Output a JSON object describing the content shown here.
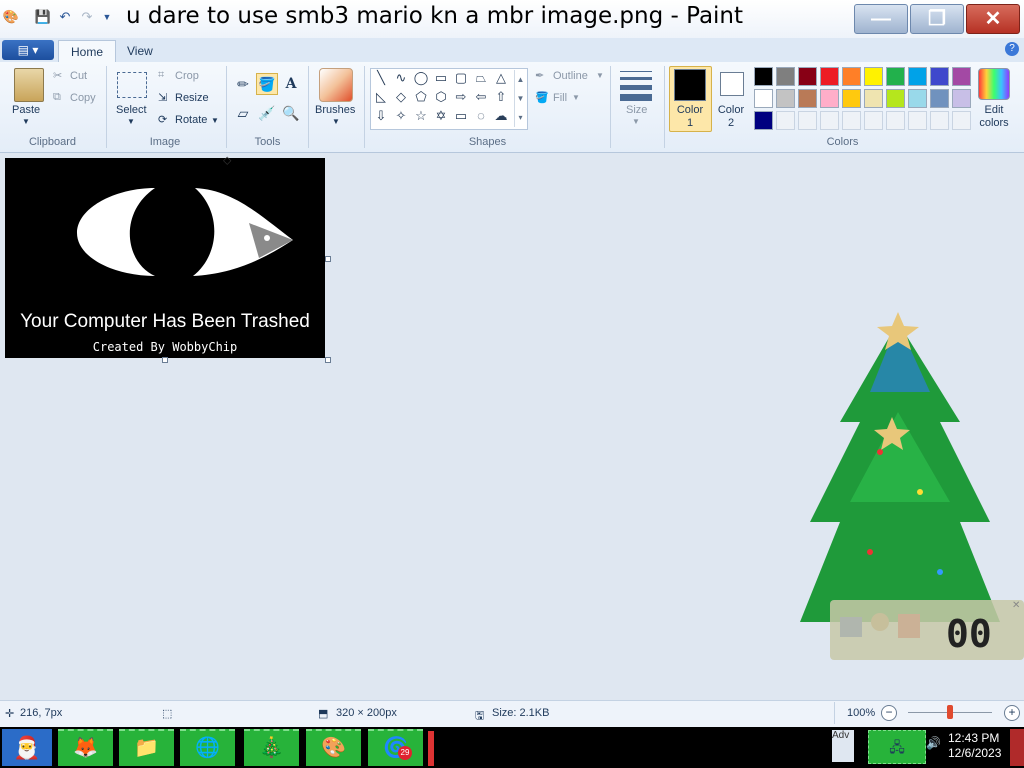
{
  "window": {
    "title": "u dare to use smb3 mario kn a mbr image.png - Paint"
  },
  "ribbon": {
    "tabs": [
      "Home",
      "View"
    ],
    "clipboard": {
      "group": "Clipboard",
      "paste": "Paste",
      "cut": "Cut",
      "copy": "Copy"
    },
    "image": {
      "group": "Image",
      "select": "Select",
      "crop": "Crop",
      "resize": "Resize",
      "rotate": "Rotate"
    },
    "tools": {
      "group": "Tools"
    },
    "brushes": {
      "label": "Brushes"
    },
    "shapes": {
      "group": "Shapes",
      "outline": "Outline",
      "fill": "Fill"
    },
    "size": {
      "label": "Size"
    },
    "colors": {
      "group": "Colors",
      "color1": "Color 1",
      "color2": "Color 2",
      "edit": "Edit colors",
      "color1_value": "#000000",
      "color2_value": "#ffffff",
      "palette": [
        "#000000",
        "#7f7f7f",
        "#880015",
        "#ed1c24",
        "#ff7f27",
        "#fff200",
        "#22b14c",
        "#00a2e8",
        "#3f48cc",
        "#a349a4",
        "#ffffff",
        "#c3c3c3",
        "#b97a57",
        "#ffaec9",
        "#ffc90e",
        "#efe4b0",
        "#b5e61d",
        "#99d9ea",
        "#7092be",
        "#c8bfe7",
        "#000080"
      ]
    }
  },
  "canvas": {
    "headline": "Your Computer Has Been Trashed",
    "credit": "Created By WobbyChip"
  },
  "status": {
    "cursor_pos": "216, 7px",
    "image_dims": "320 × 200px",
    "file_size": "Size: 2.1KB",
    "zoom": "100%",
    "zoom_level": 0.5
  },
  "taskbar": {
    "time": "12:43 PM",
    "date": "12/6/2023",
    "badge": "29",
    "tray_text": "Adv"
  },
  "desktop_widget": {
    "clock_digits": "00"
  }
}
